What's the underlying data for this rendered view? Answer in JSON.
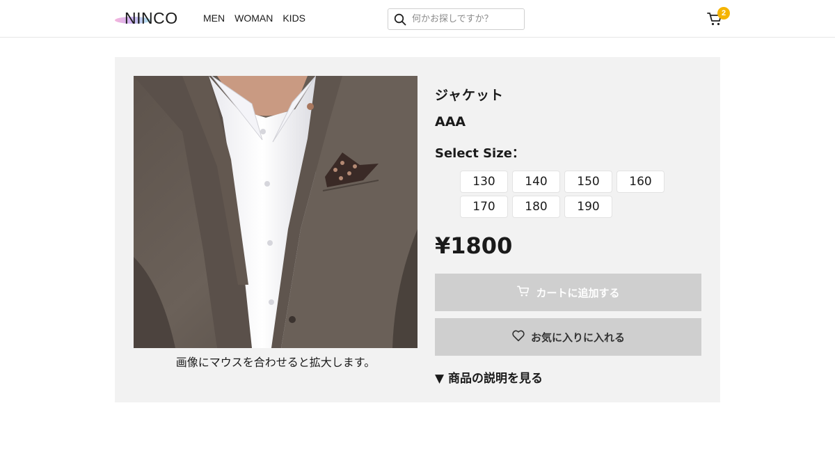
{
  "header": {
    "logo_text": "NINCO",
    "nav": [
      "MEN",
      "WOMAN",
      "KIDS"
    ],
    "search": {
      "placeholder": "何かお探しですか？",
      "icon": "search-icon"
    },
    "cart": {
      "icon": "cart-icon",
      "count": "2",
      "badge_color": "#f5b400"
    }
  },
  "product": {
    "image_caption": "画像にマウスを合わせると拡大します。",
    "title": "ジャケット",
    "brand": "AAA",
    "size_label": "Select Size：",
    "sizes": [
      "130",
      "140",
      "150",
      "160",
      "170",
      "180",
      "190"
    ],
    "price": "¥1800",
    "add_to_cart_label": "カートに追加する",
    "favorite_label": "お気に入りに入れる",
    "description_toggle": "▼ 商品の説明を見る"
  },
  "colors": {
    "panel_bg": "#f2f2f2",
    "button_bg": "#cfcfcf"
  }
}
